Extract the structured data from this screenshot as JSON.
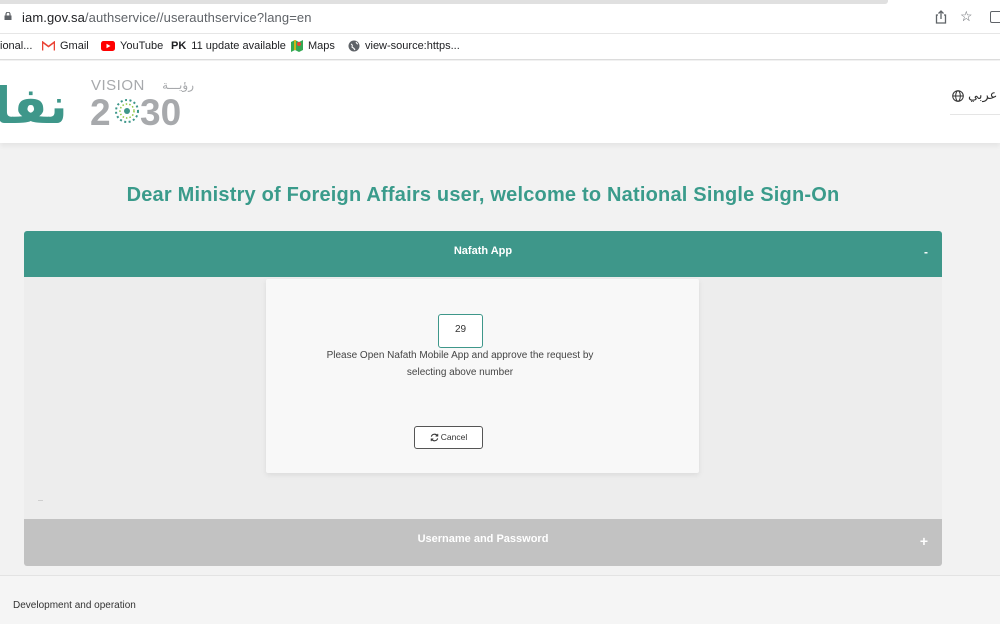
{
  "browser": {
    "url_host": "iam.gov.sa",
    "url_path": "/authservice//userauthservice?lang=en",
    "bookmarks": [
      {
        "label": "ional...",
        "icon": "partial-icon"
      },
      {
        "label": "Gmail",
        "icon": "gmail-icon"
      },
      {
        "label": "YouTube",
        "icon": "youtube-icon"
      },
      {
        "label": "11 update available",
        "icon": "pk-icon",
        "prefix": "PK"
      },
      {
        "label": "Maps",
        "icon": "maps-icon"
      },
      {
        "label": "view-source:https...",
        "icon": "globe-icon"
      }
    ]
  },
  "header": {
    "logo_text": "نفا",
    "vision_text": "VISION",
    "vision_arabic": "رؤيـــة",
    "vision_year_left": "2",
    "vision_year_right": "30",
    "language_label": "عربي"
  },
  "main": {
    "welcome": "Dear Ministry of Foreign Affairs user, welcome to National Single Sign-On",
    "nafath_section": {
      "title": "Nafath App",
      "toggle": "-",
      "code": "29",
      "instruction_line1": "Please Open Nafath Mobile App and approve the request by",
      "instruction_line2": "selecting above number",
      "cancel_label": "Cancel"
    },
    "username_section": {
      "title": "Username and Password",
      "toggle": "+"
    }
  },
  "footer": {
    "text": "Development and operation"
  },
  "colors": {
    "accent": "#3e978a",
    "heading": "#3a9b8b",
    "collapsed_header": "#c2c2c2"
  }
}
